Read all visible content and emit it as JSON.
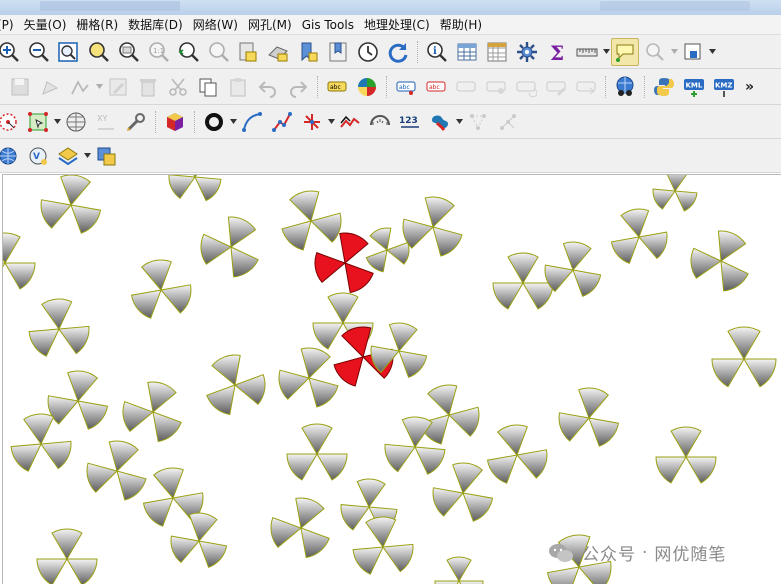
{
  "menu": {
    "items": [
      "(P)",
      "矢量(O)",
      "栅格(R)",
      "数据库(D)",
      "网络(W)",
      "网孔(M)",
      "Gis Tools",
      "地理处理(C)",
      "帮助(H)"
    ]
  },
  "toolbar": {
    "overflow_label": "»",
    "kml_label": "KML",
    "kmz_label": "KMZ",
    "label_123": "123",
    "sigma_label": "Σ",
    "xy_label": "XY"
  },
  "map": {
    "symbol_fill_gray": "#8a8a8a",
    "symbol_fill_red": "#e8121e",
    "symbol_outline": "#9aa012",
    "background": "#ffffff"
  },
  "watermark": {
    "brand": "公众号",
    "separator": "·",
    "name": "网优随笔"
  },
  "colors": {
    "titlebar": "#c4d8ef",
    "toolbar_bg": "#f0f0f0",
    "active_button": "#f2e6a8"
  }
}
